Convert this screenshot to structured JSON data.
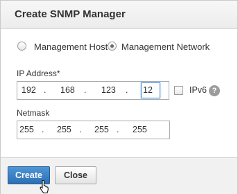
{
  "dialog": {
    "title": "Create SNMP Manager"
  },
  "mode": {
    "options": [
      {
        "label": "Management Host",
        "selected": false
      },
      {
        "label": "Management Network",
        "selected": true
      }
    ]
  },
  "ip_address": {
    "label": "IP Address*",
    "octets": [
      "192",
      "168",
      "123",
      "12"
    ],
    "ipv6_label": "IPv6",
    "ipv6_checked": false,
    "help_glyph": "?"
  },
  "netmask": {
    "label": "Netmask",
    "octets": [
      "255",
      "255",
      "255",
      "255"
    ]
  },
  "footer": {
    "create_label": "Create",
    "close_label": "Close"
  },
  "colors": {
    "primary_button": "#2d6fb3",
    "focus_border": "#4a90d9"
  },
  "icons": {
    "cursor": "hand-pointer-icon",
    "help": "help-icon"
  }
}
